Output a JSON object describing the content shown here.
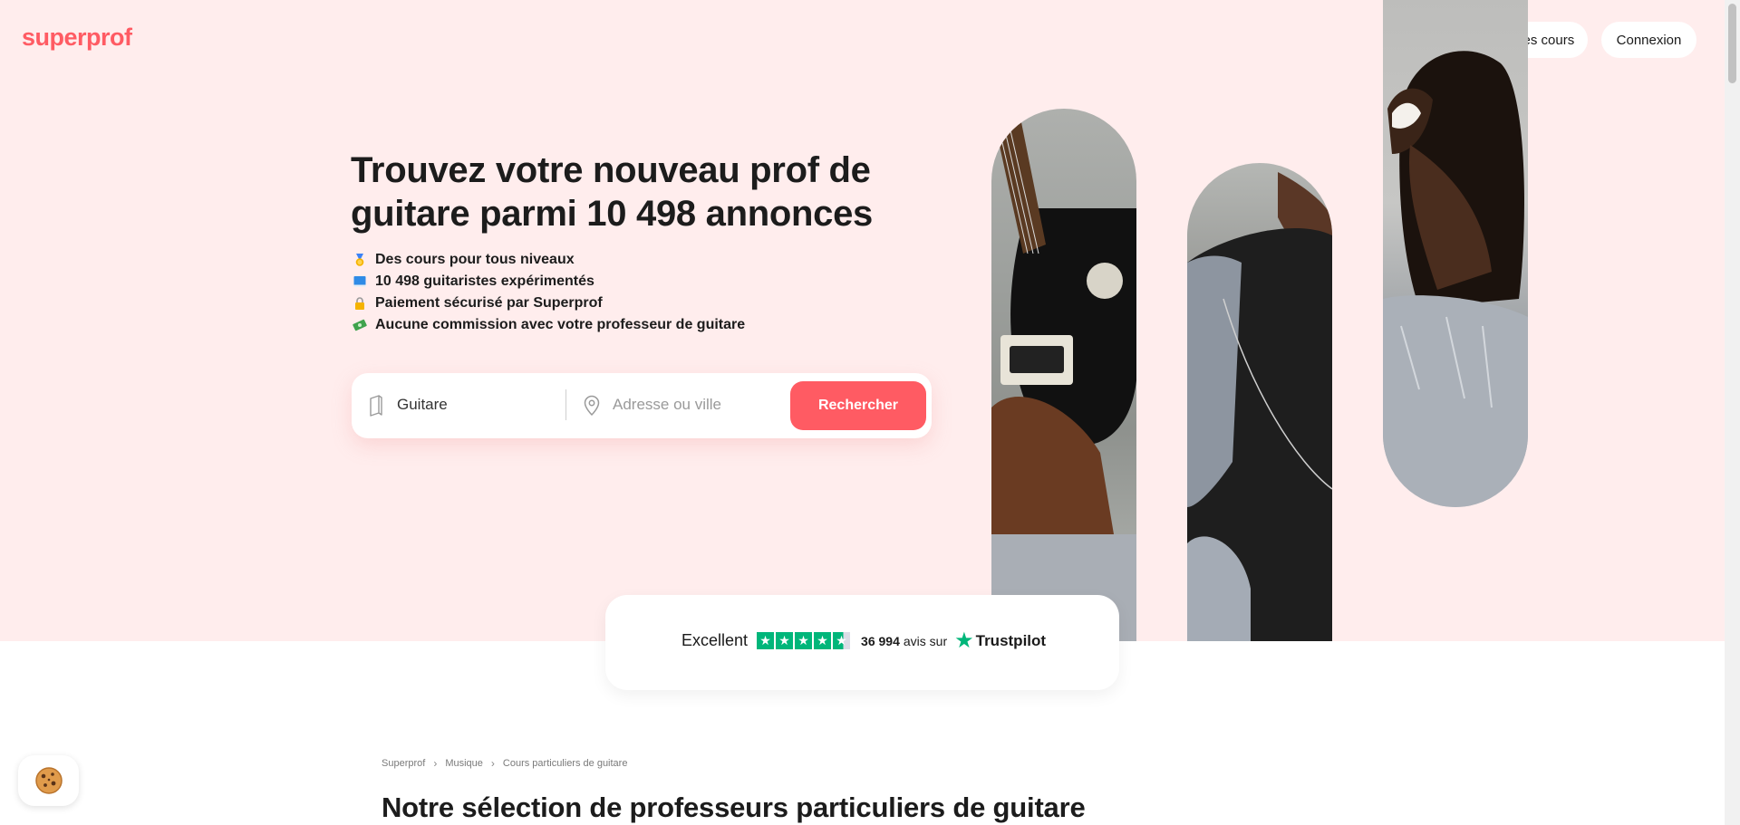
{
  "header": {
    "logo": "superprof",
    "help_icon": "question-circle-icon",
    "give_lessons_label": "Donner des cours",
    "login_label": "Connexion"
  },
  "hero": {
    "headline": "Trouvez votre nouveau prof de guitare parmi 10 498 annonces",
    "features": [
      {
        "icon": "medal-icon",
        "text": "Des cours pour tous niveaux"
      },
      {
        "icon": "book-icon",
        "text": "10 498 guitaristes expérimentés"
      },
      {
        "icon": "lock-icon",
        "text": "Paiement sécurisé par Superprof"
      },
      {
        "icon": "money-icon",
        "text": "Aucune commission avec votre professeur de guitare"
      }
    ],
    "search": {
      "subject_value": "Guitare",
      "location_placeholder": "Adresse ou ville",
      "button_label": "Rechercher"
    }
  },
  "trustpilot": {
    "rating_word": "Excellent",
    "stars": 4.5,
    "review_count": "36 994",
    "reviews_suffix": "avis sur",
    "brand": "Trustpilot"
  },
  "breadcrumb": [
    "Superprof",
    "Musique",
    "Cours particuliers de guitare"
  ],
  "section_title": "Notre sélection de professeurs particuliers de guitare",
  "colors": {
    "brand": "#ff5b63",
    "hero_bg": "#ffeded",
    "trustpilot_green": "#00b67a"
  }
}
